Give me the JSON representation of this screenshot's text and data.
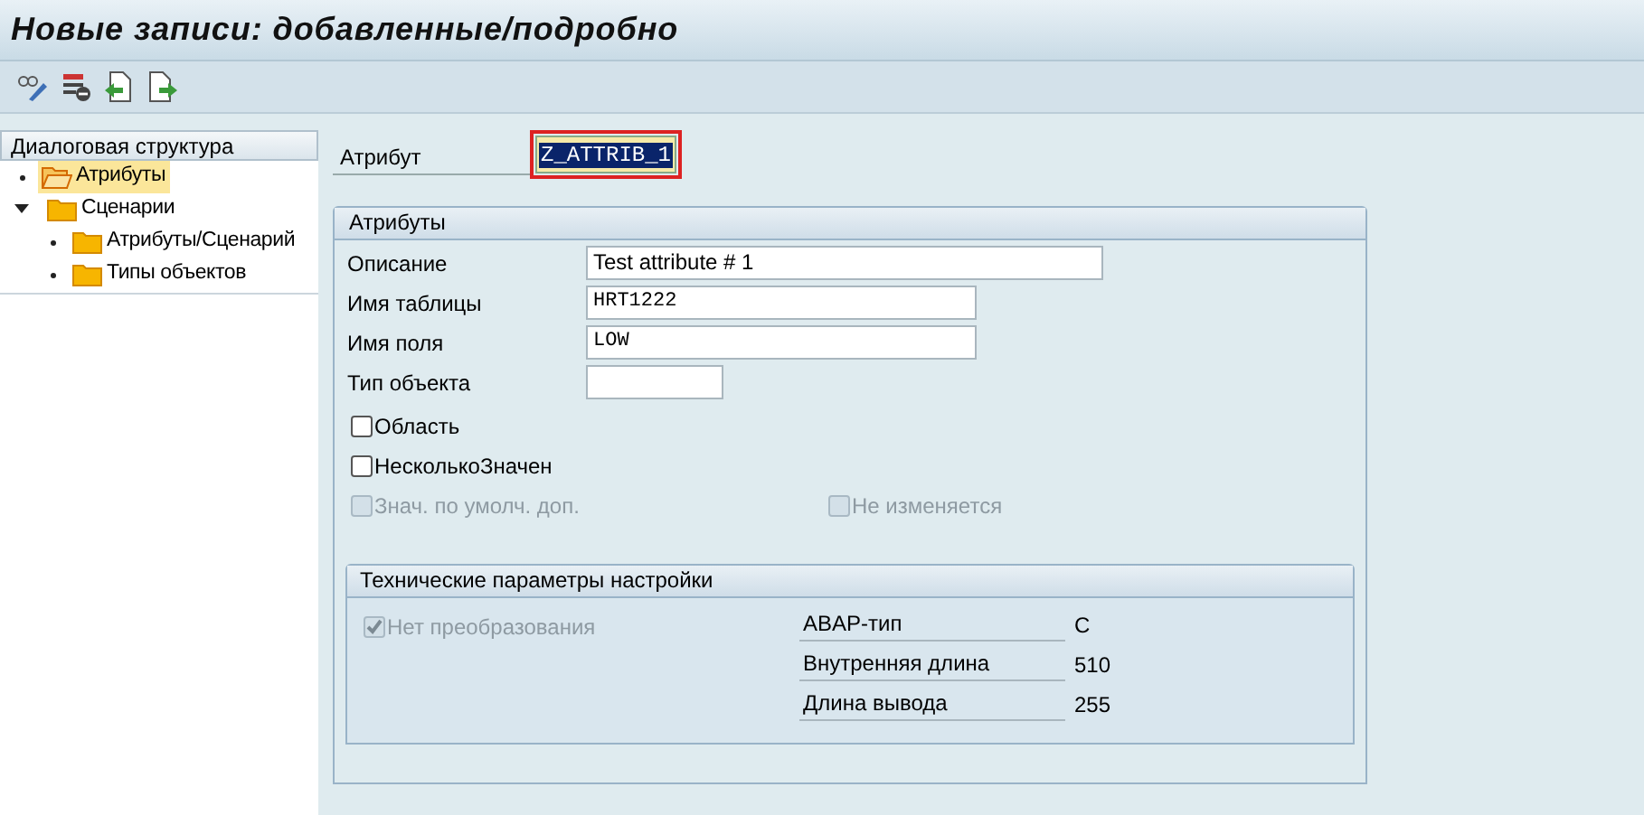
{
  "window": {
    "title": "Новые записи: добавленные/подробно"
  },
  "tree": {
    "header": "Диалоговая структура",
    "items": [
      {
        "label": "Атрибуты",
        "selected": true
      },
      {
        "label": "Сценарии",
        "selected": false,
        "expanded": true,
        "children": [
          {
            "label": "Атрибуты/Сценарий",
            "selected": false
          },
          {
            "label": "Типы объектов",
            "selected": false
          }
        ]
      }
    ]
  },
  "key_field": {
    "label": "Атрибут",
    "value": "Z_ATTRIB_1"
  },
  "attributes": {
    "title": "Атрибуты",
    "fields": [
      {
        "label": "Описание",
        "value": "Test attribute # 1",
        "kind": "wide"
      },
      {
        "label": "Имя таблицы",
        "value": "HRT1222",
        "kind": "medium"
      },
      {
        "label": "Имя поля",
        "value": "LOW",
        "kind": "medium"
      },
      {
        "label": "Тип объекта",
        "kind": "short"
      }
    ],
    "checkbox_rows": [
      [
        {
          "label": "Область",
          "checked": false,
          "disabled": false
        }
      ],
      [
        {
          "label": "НесколькоЗначен",
          "checked": false,
          "disabled": false
        }
      ],
      [
        {
          "label": "Знач. по умолч. доп.",
          "checked": false,
          "disabled": true
        },
        {
          "label": "Не изменяется",
          "checked": false,
          "disabled": true
        }
      ]
    ]
  },
  "technical": {
    "title": "Технические параметры настройки",
    "checkbox": {
      "label": "Нет преобразования",
      "checked": true,
      "disabled": true
    },
    "rows": [
      {
        "label": "ABAP-тип",
        "value": "C"
      },
      {
        "label": "Внутренняя длина",
        "value": "510"
      },
      {
        "label": "Длина вывода",
        "value": "255"
      }
    ]
  }
}
